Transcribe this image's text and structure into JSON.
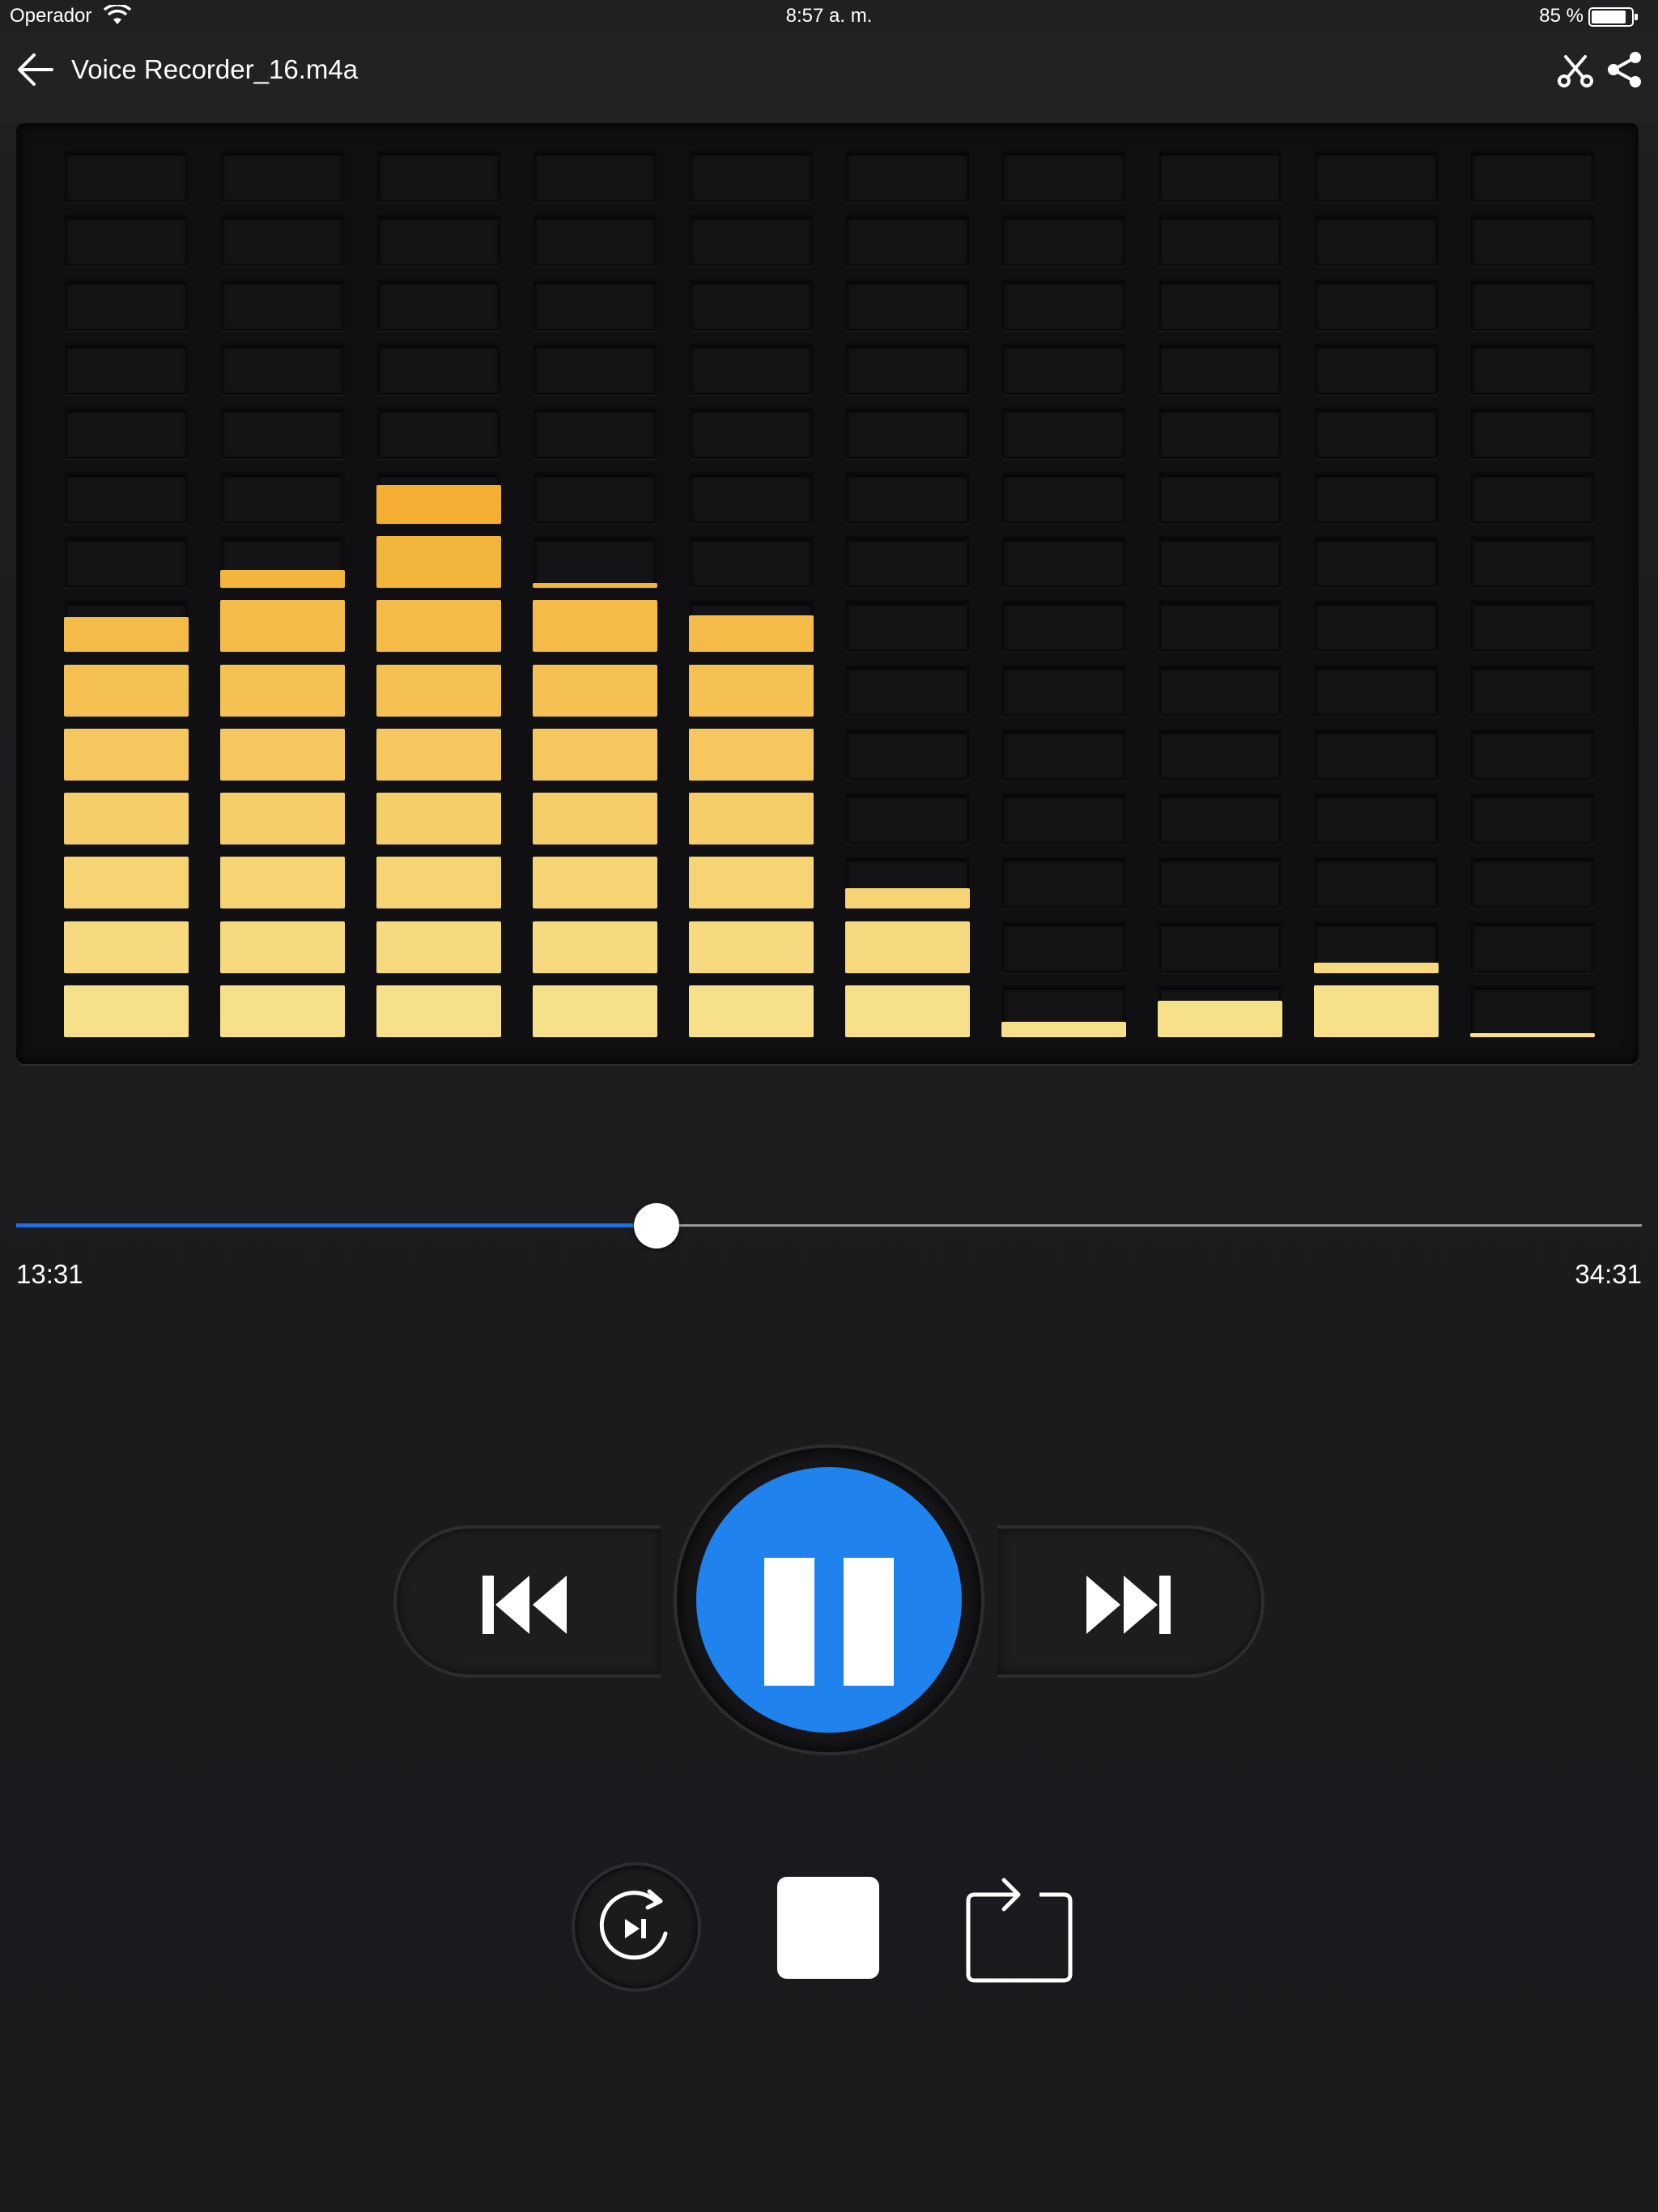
{
  "status_bar": {
    "carrier": "Operador",
    "time": "8:57 a. m.",
    "battery_percent": "85 %"
  },
  "header": {
    "title": "Voice Recorder_16.m4a",
    "back_icon": "arrow-left-icon",
    "cut_icon": "scissors-icon",
    "share_icon": "share-icon"
  },
  "equalizer": {
    "rows": 14,
    "bands": [
      {
        "name": "band-1",
        "level": 6.67
      },
      {
        "name": "band-2",
        "level": 7.35
      },
      {
        "name": "band-3",
        "level": 8.75
      },
      {
        "name": "band-4",
        "level": 7.1
      },
      {
        "name": "band-5",
        "level": 6.7
      },
      {
        "name": "band-6",
        "level": 2.4
      },
      {
        "name": "band-7",
        "level": 0.3
      },
      {
        "name": "band-8",
        "level": 0.7
      },
      {
        "name": "band-9",
        "level": 1.2
      },
      {
        "name": "band-10",
        "level": 0.08
      }
    ],
    "colors": {
      "top": "#f3ad2e",
      "bottom": "#f7e08a",
      "cell": "#141416"
    }
  },
  "playback": {
    "elapsed": "13:31",
    "total": "34:31",
    "progress": 0.394,
    "progress_color": "#1e6fe0"
  },
  "controls": {
    "previous_icon": "skip-previous-icon",
    "pause_icon": "pause-icon",
    "next_icon": "skip-next-icon",
    "replay_icon": "replay-skip-icon",
    "stop_icon": "stop-icon",
    "repeat_icon": "repeat-icon",
    "accent": "#1f82ed"
  }
}
